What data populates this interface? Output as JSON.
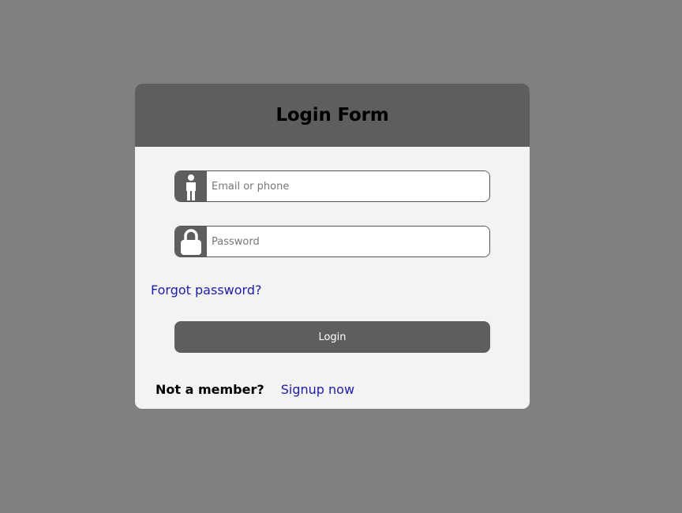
{
  "form": {
    "title": "Login Form",
    "email": {
      "placeholder": "Email or phone",
      "value": "",
      "icon": "user-icon"
    },
    "password": {
      "placeholder": "Password",
      "value": "",
      "icon": "lock-icon"
    },
    "forgot_label": "Forgot password?",
    "login_label": "Login",
    "not_member_label": "Not a member?",
    "signup_label": "Signup now"
  },
  "colors": {
    "background": "#808080",
    "card": "#f3f3f3",
    "header": "#5e5e5e",
    "button": "#5e5e5e",
    "link": "#1c1ca8"
  }
}
